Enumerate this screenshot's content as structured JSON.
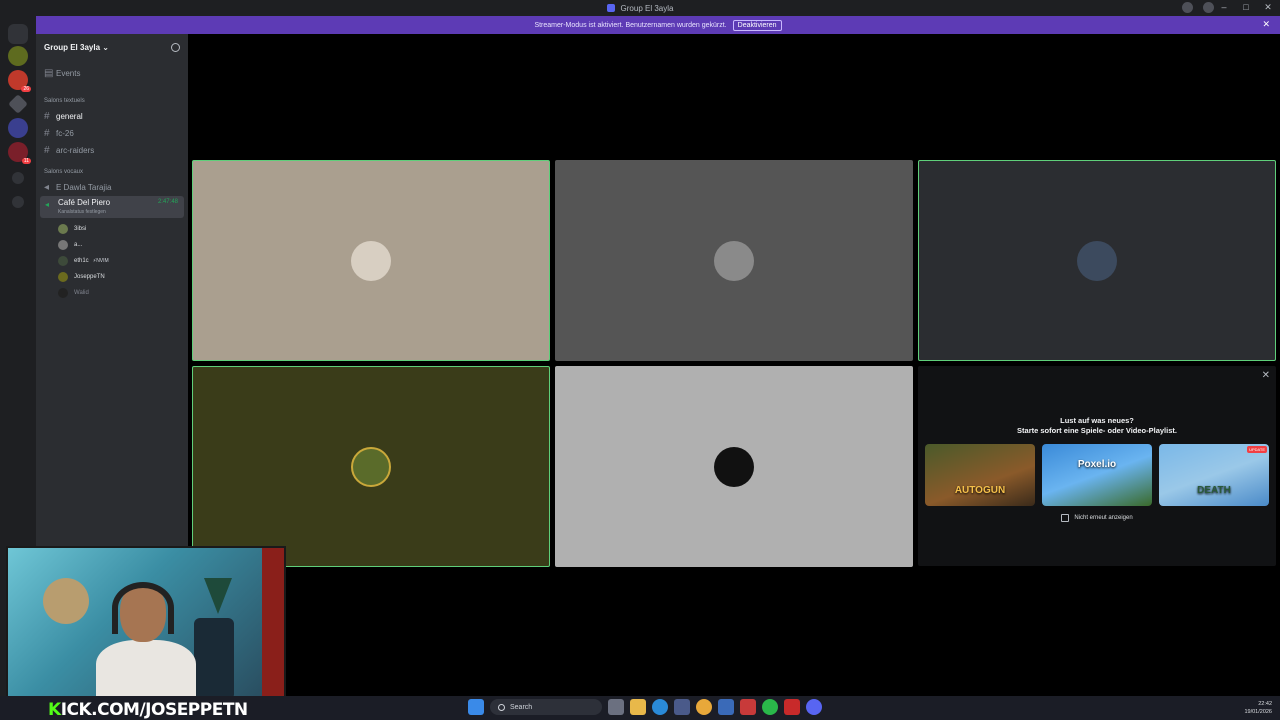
{
  "window": {
    "title": "Group El 3ayla"
  },
  "banner": {
    "text": "Streamer-Modus ist aktiviert. Benutzernamen wurden gekürzt.",
    "button_label": "Deaktivieren",
    "close_label": "✕"
  },
  "window_controls": {
    "minimize": "–",
    "maximize": "□",
    "close": "✕"
  },
  "guild_rail": {
    "badges": [
      "26",
      "11"
    ]
  },
  "server": {
    "name": "Group El 3ayla",
    "chevron": "⌄",
    "events_label": "Events",
    "text_category": "Salons textuels",
    "text_channels": [
      "general",
      "fc-26",
      "arc-raiders"
    ],
    "voice_category": "Salons vocaux",
    "voice_channels": [
      "E Dawla Tarajia"
    ],
    "active_voice": {
      "name": "Café Del Piero",
      "time": "2:47:48",
      "status": "Kanalstatus festlegen"
    },
    "members": [
      {
        "name": "3ibsi",
        "nitro": ""
      },
      {
        "name": "a...",
        "nitro": ""
      },
      {
        "name": "eth1c",
        "nitro": "⚡NVIM"
      },
      {
        "name": "JoseppeTN",
        "nitro": ""
      },
      {
        "name": "Walid",
        "nitro": ""
      }
    ]
  },
  "activity_panel": {
    "title": "Lust auf was neues?",
    "subtitle": "Starte sofort eine Spiele- oder Video-Playlist.",
    "games": [
      {
        "name": "AUTOGUN",
        "badge": ""
      },
      {
        "name": "Poxel.io",
        "badge": ""
      },
      {
        "name": "DEATH",
        "badge": "UPDATE"
      }
    ],
    "dont_show_label": "Nicht erneut anzeigen",
    "close_label": "✕"
  },
  "overlay": {
    "kick_prefix": "K",
    "kick_text": "ICK.COM/JOSEPPETN"
  },
  "taskbar": {
    "search_label": "Search",
    "time": "22:42",
    "date": "19/01/2026"
  },
  "colors": {
    "accent": "#5865f2",
    "banner": "#5d3bb5",
    "speaking": "#5fcf7a",
    "kick_green": "#53fc18"
  }
}
